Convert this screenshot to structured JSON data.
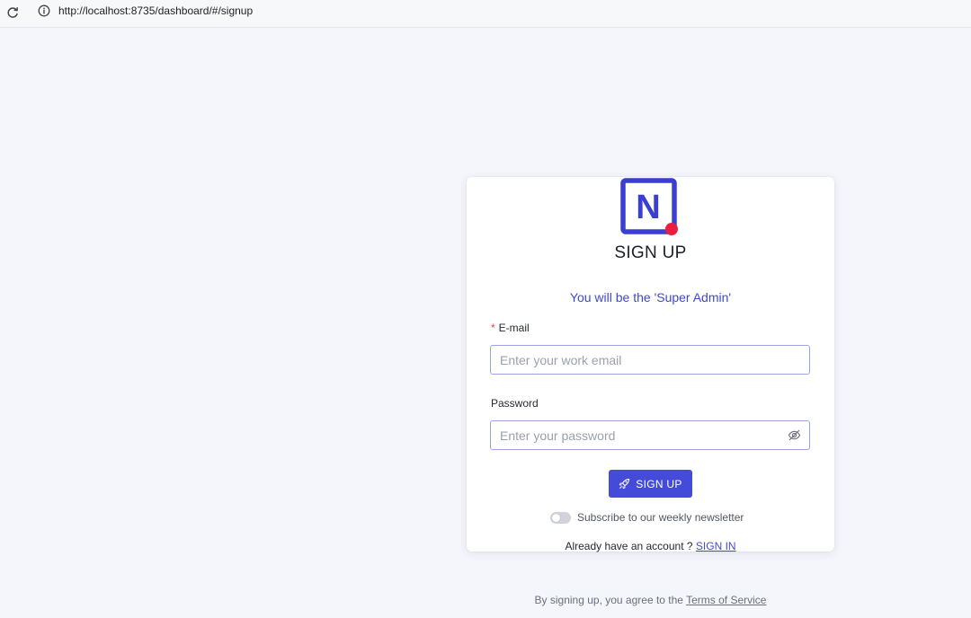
{
  "browser": {
    "url": "http://localhost:8735/dashboard/#/signup"
  },
  "brand": {
    "logo_letter": "N",
    "primary_color": "#444bd8",
    "accent_color": "#e5484d"
  },
  "signup": {
    "title": "SIGN UP",
    "subtitle": "You will be the 'Super Admin'",
    "email": {
      "required_mark": "*",
      "label": "E-mail",
      "placeholder": "Enter your work email",
      "value": ""
    },
    "password": {
      "label": "Password",
      "placeholder": "Enter your password",
      "value": ""
    },
    "submit_label": "SIGN UP",
    "newsletter": {
      "label": "Subscribe to our weekly newsletter",
      "checked": false
    },
    "signin_prompt": "Already have an account ?",
    "signin_link": "SIGN IN",
    "terms_prefix": "By signing up, you agree to the",
    "terms_link": "Terms of Service"
  }
}
